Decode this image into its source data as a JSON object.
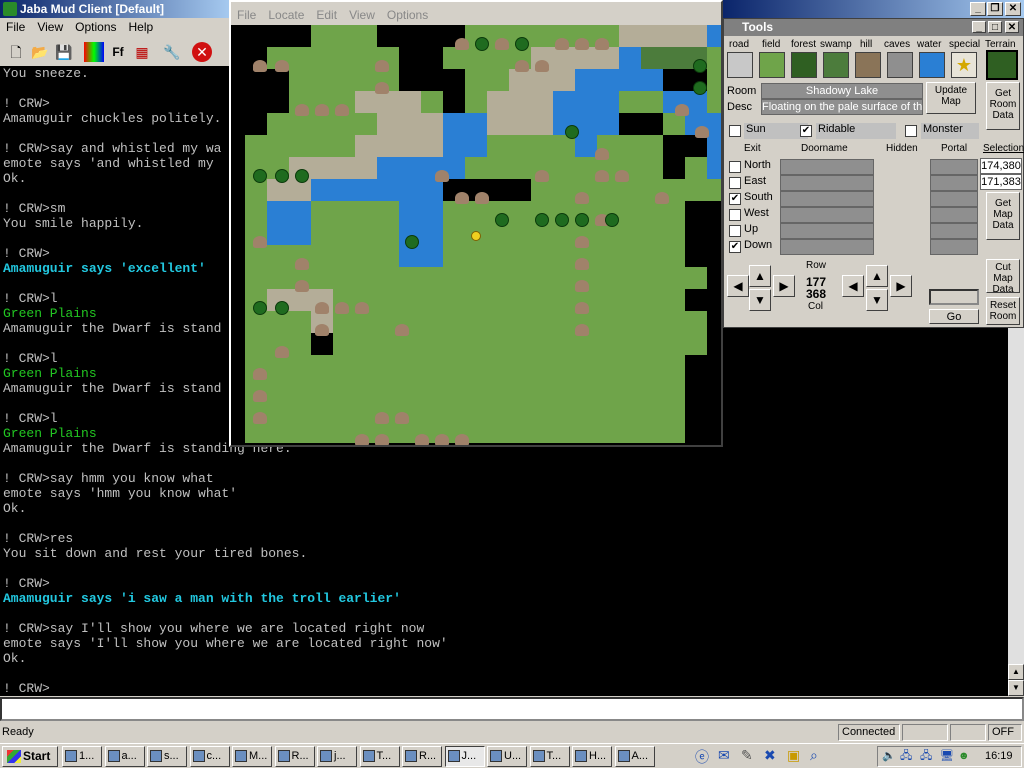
{
  "main": {
    "title": "Jaba Mud Client [Default]",
    "menus": [
      "File",
      "View",
      "Options",
      "Help"
    ],
    "toolbar_icons": [
      "new-icon",
      "open-icon",
      "save-icon",
      "colors-icon",
      "font-icon",
      "layout-icon",
      "tools-icon",
      "stop-icon"
    ],
    "font_label": "Ff"
  },
  "terminal": {
    "lines": [
      {
        "text": "You sneeze.",
        "style": ""
      },
      {
        "text": "",
        "style": ""
      },
      {
        "text": "! CRW>",
        "style": ""
      },
      {
        "text": "Amamuguir chuckles politely.",
        "style": ""
      },
      {
        "text": "",
        "style": ""
      },
      {
        "text": "! CRW>say and whistled my wa",
        "style": ""
      },
      {
        "text": "emote says 'and whistled my",
        "style": ""
      },
      {
        "text": "Ok.",
        "style": ""
      },
      {
        "text": "",
        "style": ""
      },
      {
        "text": "! CRW>sm",
        "style": ""
      },
      {
        "text": "You smile happily.",
        "style": ""
      },
      {
        "text": "",
        "style": ""
      },
      {
        "text": "! CRW>",
        "style": ""
      },
      {
        "text": "Amamuguir says 'excellent'",
        "style": "cyan"
      },
      {
        "text": "",
        "style": ""
      },
      {
        "text": "! CRW>l",
        "style": ""
      },
      {
        "text": "Green Plains",
        "style": "green"
      },
      {
        "text": "Amamuguir the Dwarf is stand",
        "style": ""
      },
      {
        "text": "",
        "style": ""
      },
      {
        "text": "! CRW>l",
        "style": ""
      },
      {
        "text": "Green Plains",
        "style": "green"
      },
      {
        "text": "Amamuguir the Dwarf is stand",
        "style": ""
      },
      {
        "text": "",
        "style": ""
      },
      {
        "text": "! CRW>l",
        "style": ""
      },
      {
        "text": "Green Plains",
        "style": "green"
      },
      {
        "text": "Amamuguir the Dwarf is standing here.",
        "style": ""
      },
      {
        "text": "",
        "style": ""
      },
      {
        "text": "! CRW>say hmm you know what",
        "style": ""
      },
      {
        "text": "emote says 'hmm you know what'",
        "style": ""
      },
      {
        "text": "Ok.",
        "style": ""
      },
      {
        "text": "",
        "style": ""
      },
      {
        "text": "! CRW>res",
        "style": ""
      },
      {
        "text": "You sit down and rest your tired bones.",
        "style": ""
      },
      {
        "text": "",
        "style": ""
      },
      {
        "text": "! CRW>",
        "style": ""
      },
      {
        "text": "Amamuguir says 'i saw a man with the troll earlier'",
        "style": "cyan"
      },
      {
        "text": "",
        "style": ""
      },
      {
        "text": "! CRW>say I'll show you where we are located right now",
        "style": ""
      },
      {
        "text": "emote says 'I'll show you where we are located right now'",
        "style": ""
      },
      {
        "text": "Ok.",
        "style": ""
      },
      {
        "text": "",
        "style": ""
      },
      {
        "text": "! CRW>",
        "style": ""
      }
    ]
  },
  "status": {
    "ready": "Ready",
    "connection": "Connected",
    "mode": "OFF"
  },
  "map_window": {
    "menus": [
      "File",
      "Locate",
      "Edit",
      "View",
      "Options"
    ]
  },
  "tools": {
    "title": "Tools",
    "terrain_labels": [
      "road",
      "field",
      "forest",
      "swamp",
      "hill",
      "caves",
      "water",
      "special",
      "Terrain"
    ],
    "room_label": "Room",
    "room_name": "Shadowy Lake",
    "desc_label": "Desc",
    "room_desc": "Floating on the pale surface of this",
    "update_map_btn": "Update Map",
    "get_room_data_btn": "Get Room Data",
    "sun_label": "Sun",
    "sun_checked": false,
    "ridable_label": "Ridable",
    "ridable_checked": true,
    "monster_label": "Monster",
    "monster_checked": false,
    "exit_header": "Exit",
    "doorname_header": "Doorname",
    "hidden_header": "Hidden",
    "portal_header": "Portal",
    "selection_header": "Selection",
    "exits": [
      {
        "label": "North",
        "checked": false
      },
      {
        "label": "East",
        "checked": false
      },
      {
        "label": "South",
        "checked": true
      },
      {
        "label": "West",
        "checked": false
      },
      {
        "label": "Up",
        "checked": false
      },
      {
        "label": "Down",
        "checked": true
      }
    ],
    "selection_values": [
      "174,380",
      "171,383"
    ],
    "get_map_data_btn": "Get Map Data",
    "row_label": "Row",
    "row_value": "177",
    "col_value": "368",
    "col_label": "Col",
    "cut_map_data_btn": "Cut Map Data",
    "go_btn": "Go",
    "reset_room_btn": "Reset Room"
  },
  "taskbar": {
    "start_label": "Start",
    "tasks": [
      "1...",
      "a...",
      "s...",
      "c...",
      "M...",
      "R...",
      "j...",
      "T...",
      "R...",
      "J...",
      "U...",
      "T...",
      "H...",
      "A..."
    ],
    "active_task_index": 9,
    "clock": "16:19"
  }
}
